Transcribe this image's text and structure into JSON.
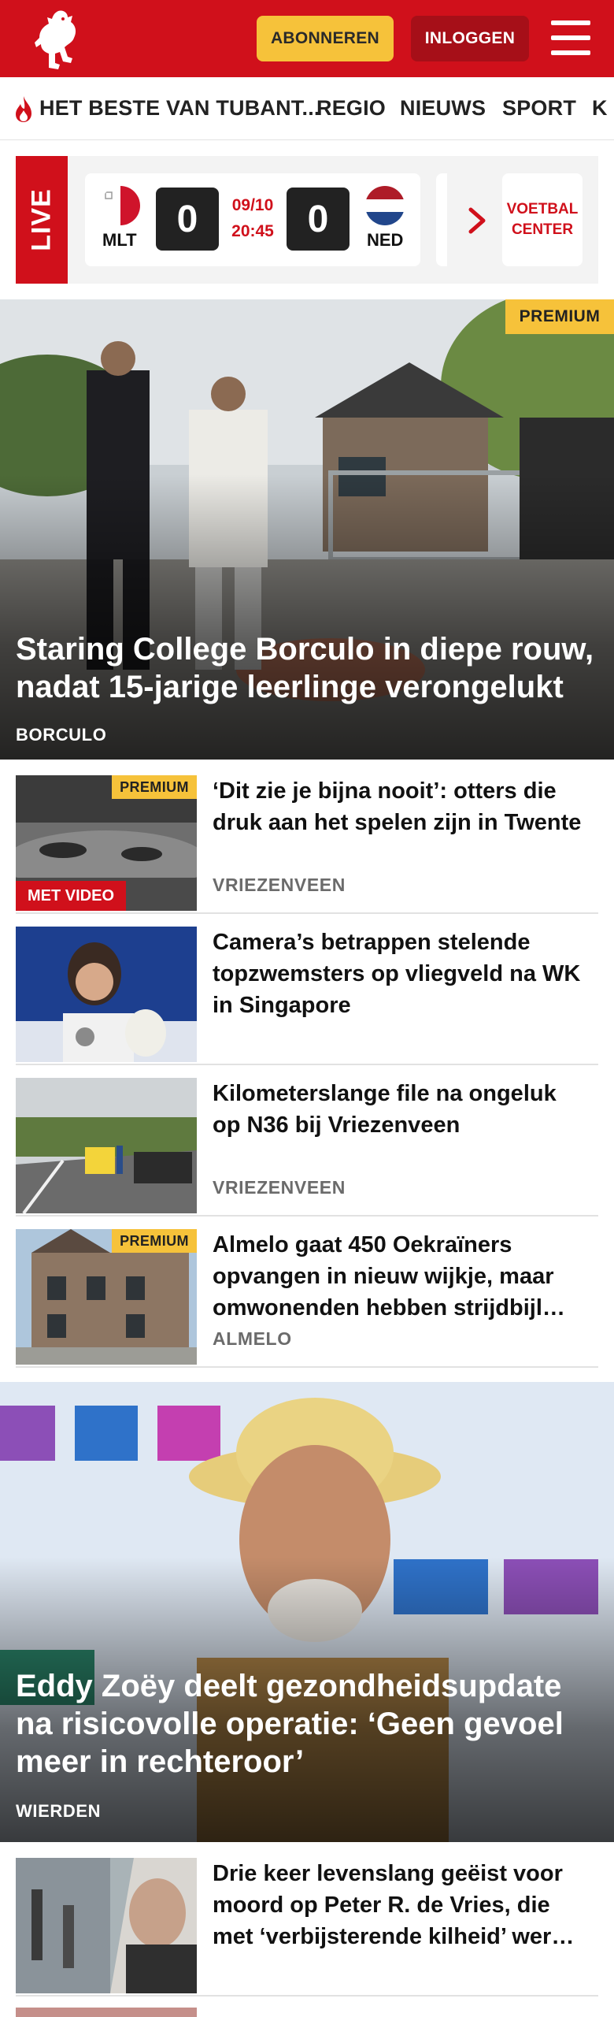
{
  "header": {
    "subscribe_label": "ABONNEREN",
    "login_label": "INLOGGEN",
    "brand_color": "#d0101b"
  },
  "sections": {
    "items": [
      {
        "label": "HET BESTE VAN TUBANT..."
      },
      {
        "label": "REGIO"
      },
      {
        "label": "NIEUWS"
      },
      {
        "label": "SPORT"
      },
      {
        "label": "K"
      }
    ]
  },
  "live": {
    "tag": "LIVE",
    "home_code": "MLT",
    "away_code": "NED",
    "home_score": "0",
    "away_score": "0",
    "date": "09/10",
    "time": "20:45",
    "voetbal_center": "VOETBAL CENTER"
  },
  "hero1": {
    "badge": "PREMIUM",
    "title": "Staring College Borculo in diepe rouw, nadat 15-jarige leerlinge verongelukt",
    "place": "BORCULO"
  },
  "articles": [
    {
      "title": "‘Dit zie je bijna nooit’: otters die druk aan het spelen zijn in Twente",
      "place": "VRIEZENVEEN",
      "badge": "PREMIUM",
      "video": "MET VIDEO"
    },
    {
      "title": "Camera’s betrappen stelende topzwemsters op vliegveld na WK in Singapore",
      "place": ""
    },
    {
      "title": "Kilometerslange file na ongeluk op N36 bij Vriezenveen",
      "place": "VRIEZENVEEN"
    },
    {
      "title": "Almelo gaat 450 Oekraïners opvangen in nieuw wijkje, maar omwonenden hebben strijdbijl…",
      "place": "ALMELO",
      "badge": "PREMIUM"
    }
  ],
  "hero2": {
    "title": "Eddy Zoëy deelt gezondheidsupdate na risicovolle operatie: ‘Geen gevoel meer in rechteroor’",
    "place": "WIERDEN"
  },
  "articles2": [
    {
      "title": "Drie keer levenslang geëist voor moord op Peter R. de Vries, die met ‘verbijsterende kilheid’ wer…"
    }
  ]
}
